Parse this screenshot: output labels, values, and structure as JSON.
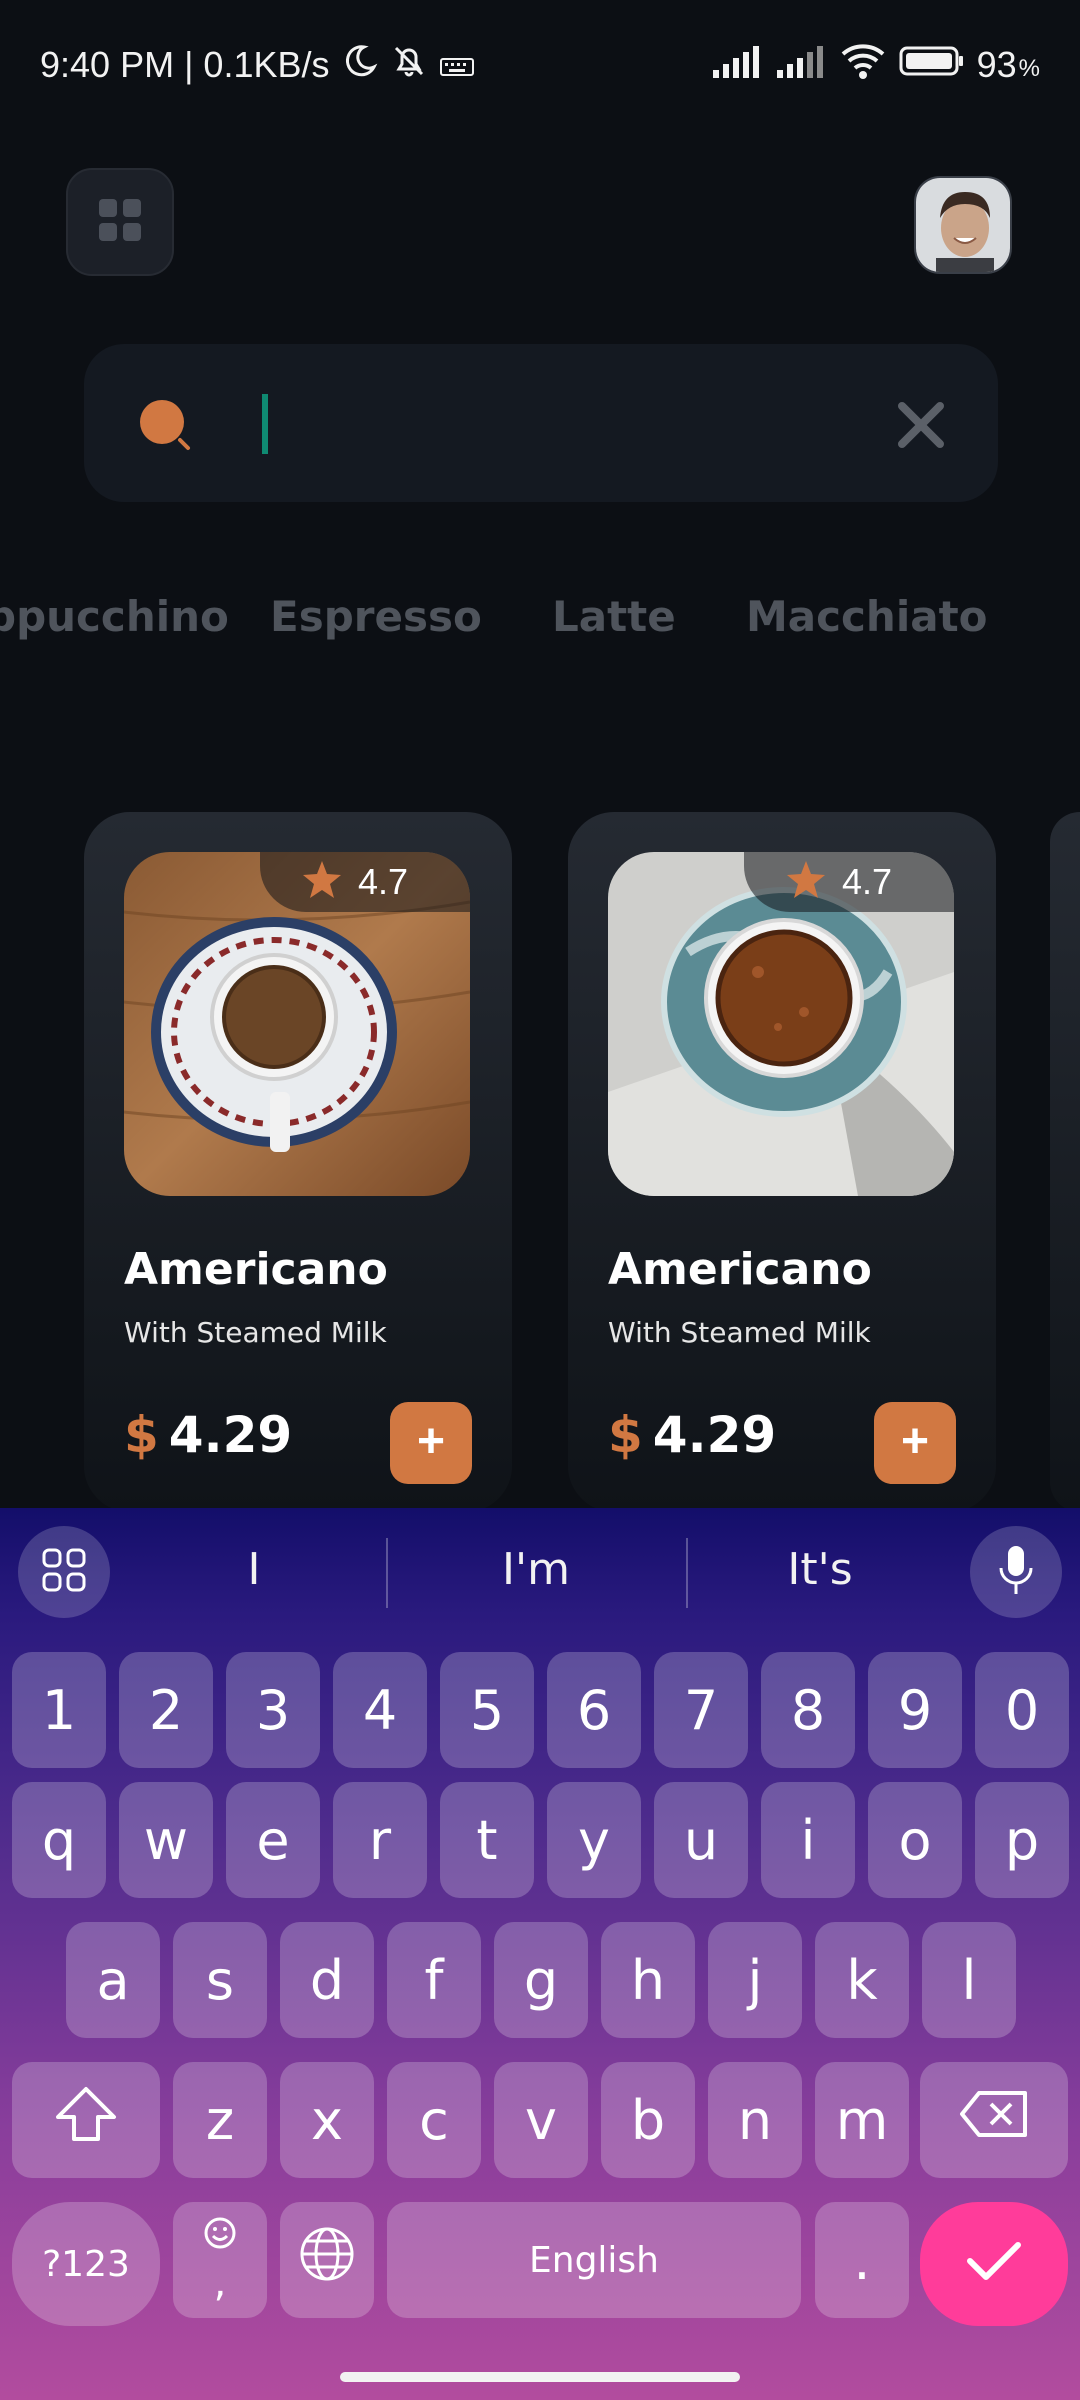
{
  "status_bar": {
    "time_network": "9:40 PM | 0.1KB/s",
    "battery": "93"
  },
  "search": {
    "value": "",
    "placeholder": ""
  },
  "categories": [
    "ppucchino",
    "Espresso",
    "Latte",
    "Macchiato"
  ],
  "products": [
    {
      "rating": "4.7",
      "name": "Americano",
      "subtitle": "With Steamed Milk",
      "currency": "$",
      "price": "4.29",
      "add_label": "+"
    },
    {
      "rating": "4.7",
      "name": "Americano",
      "subtitle": "With Steamed Milk",
      "currency": "$",
      "price": "4.29",
      "add_label": "+"
    }
  ],
  "keyboard": {
    "suggestions": [
      "I",
      "I'm",
      "It's"
    ],
    "row_numbers": [
      "1",
      "2",
      "3",
      "4",
      "5",
      "6",
      "7",
      "8",
      "9",
      "0"
    ],
    "row_1": [
      "q",
      "w",
      "e",
      "r",
      "t",
      "y",
      "u",
      "i",
      "o",
      "p"
    ],
    "row_2": [
      "a",
      "s",
      "d",
      "f",
      "g",
      "h",
      "j",
      "k",
      "l"
    ],
    "row_3": [
      "z",
      "x",
      "c",
      "v",
      "b",
      "n",
      "m"
    ],
    "symbols_label": "?123",
    "comma_label": ",",
    "space_label": "English",
    "period_label": "."
  },
  "colors": {
    "accent": "#d17842",
    "background": "#0c0f14",
    "enter_key": "#ff3c9a"
  }
}
